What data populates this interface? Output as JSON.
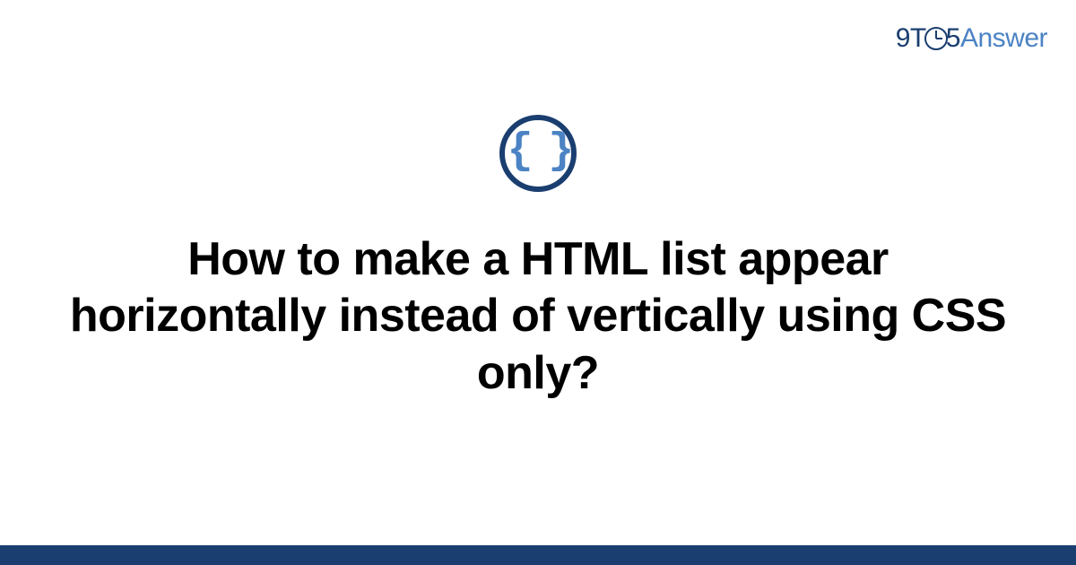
{
  "logo": {
    "part1": "9T",
    "part2": "5",
    "part3": "Answer"
  },
  "icon": {
    "braces": "{ }"
  },
  "title": "How to make a HTML list appear horizontally instead of vertically using CSS only?",
  "colors": {
    "dark_blue": "#1a3e6f",
    "light_blue": "#4b83c4"
  }
}
